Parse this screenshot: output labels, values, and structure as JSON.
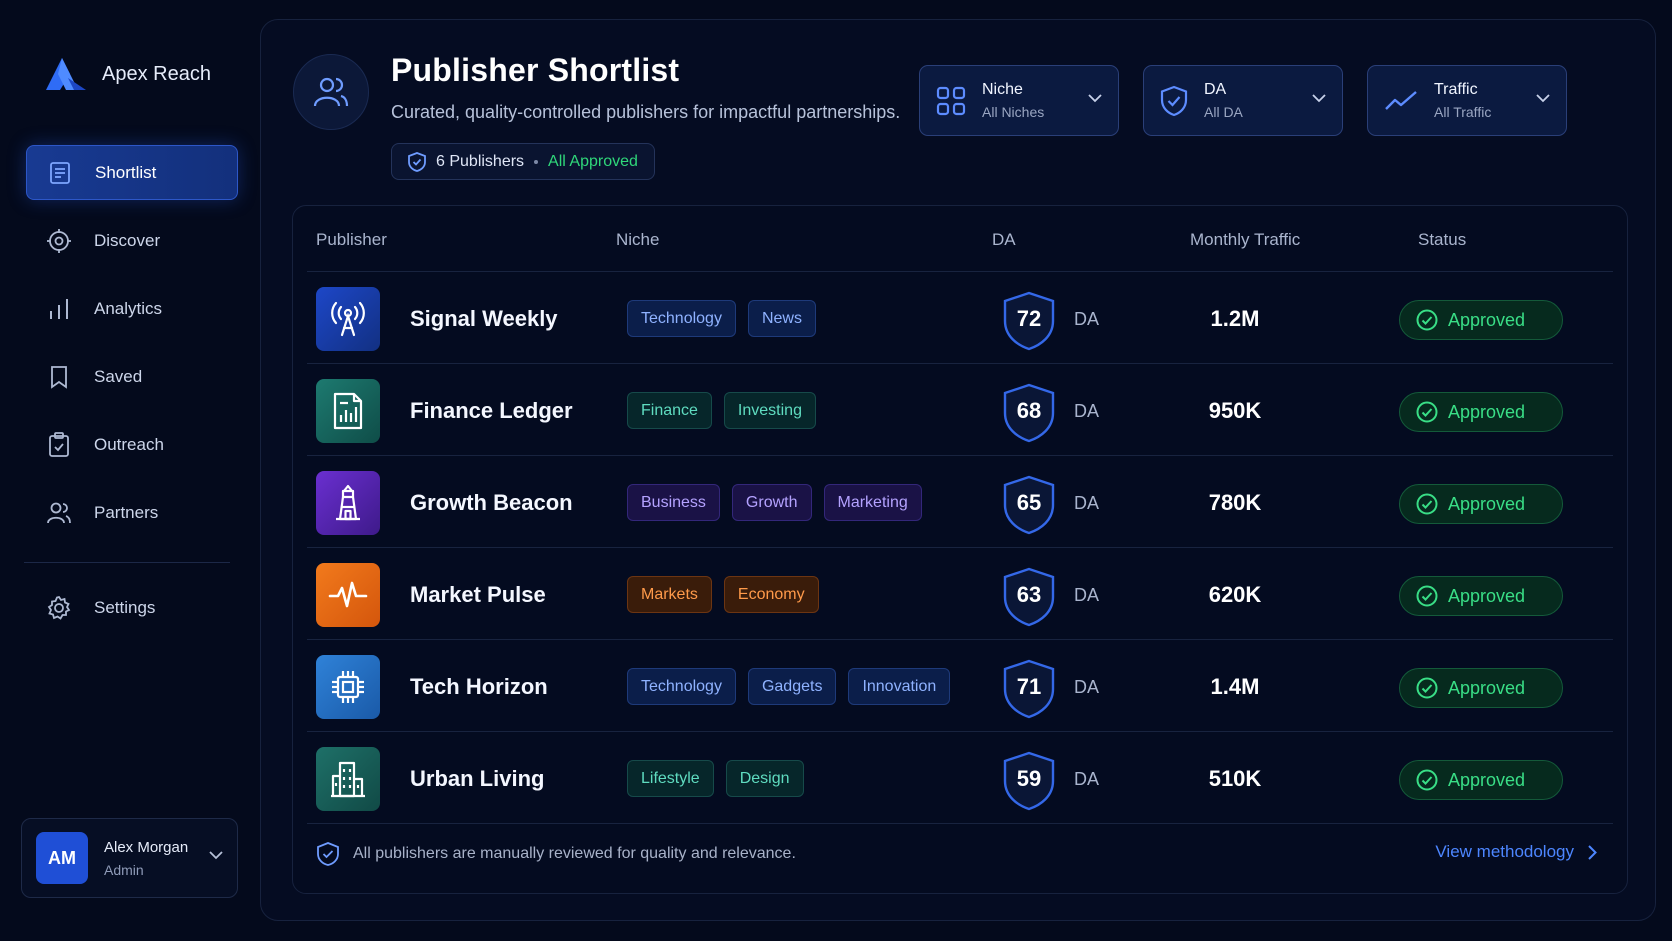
{
  "brand": {
    "name": "Apex Reach"
  },
  "sidebar": {
    "items": [
      {
        "label": "Shortlist",
        "icon": "document-list-icon"
      },
      {
        "label": "Discover",
        "icon": "crosshair-icon"
      },
      {
        "label": "Analytics",
        "icon": "bar-chart-icon"
      },
      {
        "label": "Saved",
        "icon": "bookmark-icon"
      },
      {
        "label": "Outreach",
        "icon": "clipboard-check-icon"
      },
      {
        "label": "Partners",
        "icon": "users-icon"
      }
    ],
    "settings": {
      "label": "Settings",
      "icon": "gear-icon"
    }
  },
  "user": {
    "initials": "AM",
    "name": "Alex Morgan",
    "role": "Admin"
  },
  "header": {
    "title": "Publisher Shortlist",
    "subtitle": "Curated, quality-controlled publishers for impactful partnerships.",
    "count_label": "6 Publishers",
    "status_label": "All Approved"
  },
  "filters": {
    "niche": {
      "label": "Niche",
      "value": "All Niches"
    },
    "da": {
      "label": "DA",
      "value": "All DA"
    },
    "traffic": {
      "label": "Traffic",
      "value": "All Traffic"
    }
  },
  "table": {
    "columns": {
      "publisher": "Publisher",
      "niche": "Niche",
      "da": "DA",
      "traffic": "Monthly Traffic",
      "status": "Status"
    },
    "da_suffix": "DA",
    "rows": [
      {
        "name": "Signal Weekly",
        "tags": [
          "Technology",
          "News"
        ],
        "da": "72",
        "traffic": "1.2M",
        "status": "Approved"
      },
      {
        "name": "Finance Ledger",
        "tags": [
          "Finance",
          "Investing"
        ],
        "da": "68",
        "traffic": "950K",
        "status": "Approved"
      },
      {
        "name": "Growth Beacon",
        "tags": [
          "Business",
          "Growth",
          "Marketing"
        ],
        "da": "65",
        "traffic": "780K",
        "status": "Approved"
      },
      {
        "name": "Market Pulse",
        "tags": [
          "Markets",
          "Economy"
        ],
        "da": "63",
        "traffic": "620K",
        "status": "Approved"
      },
      {
        "name": "Tech Horizon",
        "tags": [
          "Technology",
          "Gadgets",
          "Innovation"
        ],
        "da": "71",
        "traffic": "1.4M",
        "status": "Approved"
      },
      {
        "name": "Urban Living",
        "tags": [
          "Lifestyle",
          "Design"
        ],
        "da": "59",
        "traffic": "510K",
        "status": "Approved"
      }
    ]
  },
  "footer": {
    "note": "All publishers are manually reviewed for quality and relevance.",
    "link": "View methodology"
  },
  "colors": {
    "accent": "#2d6bff",
    "approved": "#39de86",
    "background": "#040a1c"
  }
}
